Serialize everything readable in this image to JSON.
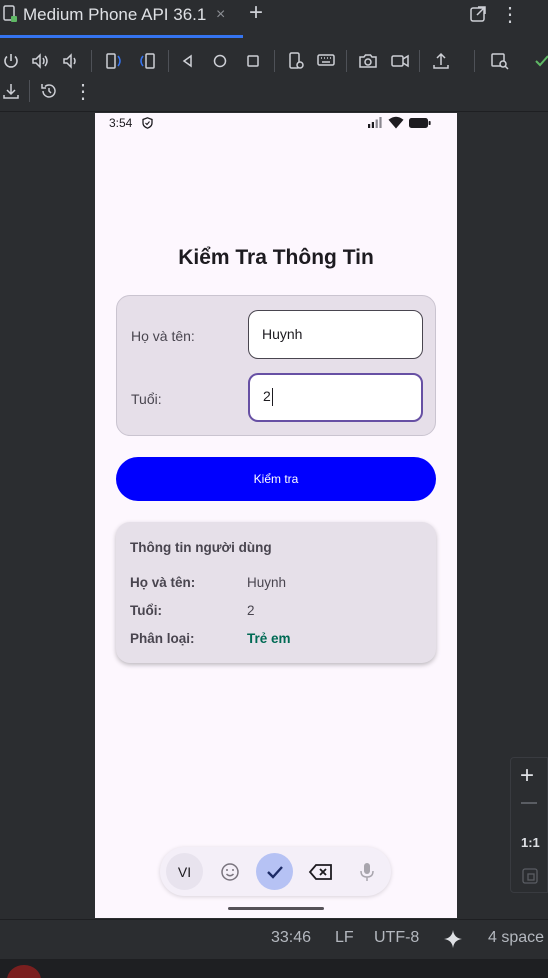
{
  "ide": {
    "tab_label": "Medium Phone API 36.1",
    "close_symbol": "×",
    "add_symbol": "+",
    "more_symbol": "⋮",
    "accent_color": "#3574f0",
    "toolbar_icons": [
      "power-icon",
      "volume-up-icon",
      "volume-down-icon",
      "rotate-left-icon",
      "rotate-right-icon",
      "back-icon",
      "home-icon",
      "overview-icon",
      "device-settings-icon",
      "keyboard-icon",
      "camera-icon",
      "record-video-icon",
      "upload-icon",
      "snapshot-icon",
      "check-icon",
      "download-icon",
      "reset-icon",
      "more-icon"
    ],
    "status": {
      "position": "33:46",
      "line_ending": "LF",
      "encoding": "UTF-8",
      "indent": "4 space"
    },
    "zoom": {
      "plus": "+",
      "one_to_one": "1:1"
    }
  },
  "phone": {
    "status_bar": {
      "time": "3:54"
    },
    "title": "Kiểm Tra Thông Tin",
    "form": {
      "name_label": "Họ và tên:",
      "name_value": "Huynh",
      "age_label": "Tuổi:",
      "age_value": "2"
    },
    "check_button": "Kiểm tra",
    "button_color": "#0000ff",
    "result": {
      "heading": "Thông tin người dùng",
      "name_key": "Họ và tên:",
      "name_value": "Huynh",
      "age_key": "Tuổi:",
      "age_value": "2",
      "class_key": "Phân loại:",
      "class_value": "Trẻ em",
      "class_color": "#006a54"
    },
    "keyboard": {
      "language": "VI"
    }
  }
}
